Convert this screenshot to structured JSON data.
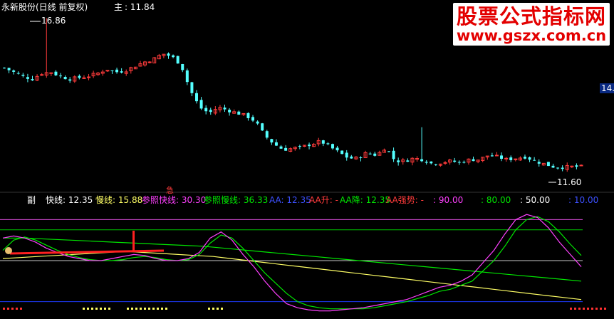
{
  "header": {
    "title": "永新股份(日线 前复权)",
    "main_label": "主",
    "main_value": ": 11.84"
  },
  "watermark": {
    "line1": "股票公式指标网",
    "line2": "www.gszx.com.cn"
  },
  "price_axis_tag": "14.",
  "colors": {
    "up": "#ff3b3b",
    "down": "#54ffff",
    "fast": "#ff40ff",
    "slow": "#00e600",
    "ref_fast": "#ff40ff",
    "ref_slow": "#ffff66",
    "level90": "#d84bd8",
    "level80": "#00c800",
    "level50": "#c8c8c8",
    "level10": "#1e3cff"
  },
  "indicator": {
    "name": "副",
    "items": [
      {
        "text": "快线: 12.35",
        "color": "#ffffff"
      },
      {
        "text": "慢线: 15.88",
        "color": "#ffff66"
      },
      {
        "text": "参照快线: 30.30",
        "color": "#ff40ff"
      },
      {
        "text": "参照慢线: 36.33",
        "color": "#00e600"
      },
      {
        "text": "AA: 12.35",
        "color": "#3c50ff"
      },
      {
        "text": "AA升: -",
        "color": "#ff3b3b"
      },
      {
        "text": "AA降: 12.35",
        "color": "#00e600"
      },
      {
        "text": "AA强势: -",
        "color": "#ff3b3b"
      },
      {
        "text": ": 90.00",
        "color": "#ff40ff"
      },
      {
        "text": ": 80.00",
        "color": "#00e600"
      },
      {
        "text": ": 50.00",
        "color": "#ffffff"
      },
      {
        "text": ": 10.00",
        "color": "#3c50ff"
      }
    ],
    "signal_char": "急"
  },
  "chart_data": [
    {
      "type": "candlestick",
      "title": "永新股份(日线 前复权)",
      "annotations": {
        "high": "16.86",
        "low": "11.60"
      },
      "close_path": [
        15.1,
        14.95,
        14.8,
        14.7,
        14.9,
        14.95,
        14.8,
        14.7,
        14.75,
        14.8,
        14.9,
        15.05,
        14.95,
        15.0,
        15.15,
        15.3,
        15.4,
        15.6,
        15.5,
        15.2,
        14.3,
        13.7,
        13.5,
        13.7,
        13.6,
        13.5,
        13.4,
        13.2,
        12.7,
        12.4,
        12.2,
        12.25,
        12.3,
        12.4,
        12.5,
        12.3,
        12.1,
        11.9,
        11.9,
        12.1,
        12.0,
        12.3,
        11.8,
        11.8,
        11.9,
        11.85,
        11.7,
        11.75,
        11.8,
        11.75,
        11.85,
        11.85,
        12.0,
        11.95,
        11.85,
        11.9,
        11.95,
        11.8,
        11.7,
        11.6,
        11.58,
        11.6,
        11.6
      ]
    },
    {
      "type": "line",
      "name": "indicator",
      "levels": [
        90,
        80,
        50,
        10
      ],
      "series": [
        {
          "name": "快线",
          "values": [
            72,
            74,
            72,
            68,
            62,
            58,
            54,
            52,
            50,
            50,
            52,
            54,
            56,
            55,
            52,
            50,
            50,
            52,
            58,
            72,
            78,
            70,
            56,
            44,
            30,
            18,
            8,
            4,
            2,
            1,
            1,
            2,
            3,
            4,
            6,
            8,
            10,
            12,
            16,
            20,
            24,
            26,
            30,
            36,
            48,
            60,
            76,
            90,
            95,
            92,
            82,
            68,
            56,
            44
          ]
        },
        {
          "name": "慢线",
          "values": [
            60,
            70,
            73,
            70,
            65,
            60,
            56,
            53,
            51,
            50,
            50,
            51,
            53,
            54,
            53,
            51,
            50,
            51,
            56,
            67,
            75,
            72,
            62,
            50,
            38,
            28,
            18,
            10,
            6,
            4,
            3,
            3,
            3,
            3,
            4,
            6,
            8,
            10,
            13,
            16,
            20,
            22,
            26,
            30,
            40,
            50,
            64,
            80,
            90,
            93,
            88,
            78,
            66,
            55
          ]
        },
        {
          "name": "参照快线",
          "values": [
            72,
            72,
            71,
            70,
            69,
            68,
            67,
            66,
            65,
            64,
            62,
            60,
            58,
            56,
            54,
            52,
            50,
            48,
            46,
            44,
            42,
            40,
            38,
            36,
            34,
            32,
            30
          ]
        },
        {
          "name": "参照慢线",
          "values": [
            52,
            53,
            54,
            55,
            56,
            57,
            58,
            59,
            58,
            57,
            56,
            55,
            54,
            52,
            50,
            48,
            46,
            44,
            42,
            40,
            38,
            36,
            34,
            32,
            30,
            28,
            26,
            24,
            22,
            20,
            18,
            16,
            14,
            12
          ]
        }
      ]
    }
  ]
}
